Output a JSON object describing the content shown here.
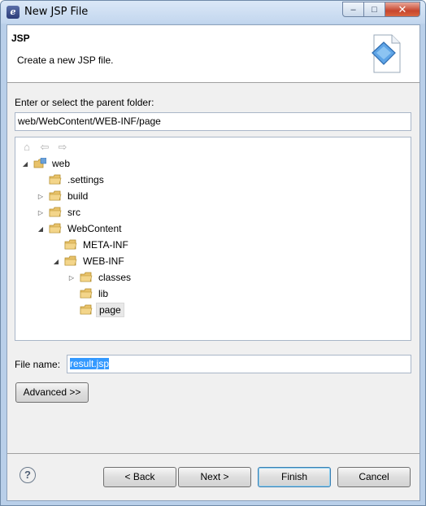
{
  "window": {
    "title": "New JSP File",
    "controls": {
      "minimize": "‒",
      "maximize": "□",
      "close": "✕"
    }
  },
  "banner": {
    "title": "JSP",
    "description": "Create a new JSP file."
  },
  "folder_section": {
    "label": "Enter or select the parent folder:",
    "value": "web/WebContent/WEB-INF/page"
  },
  "tree": {
    "toolbar_icons": [
      "home-icon",
      "back-arrow-icon",
      "forward-arrow-icon"
    ],
    "items": [
      {
        "label": "web",
        "expander": "expanded",
        "type": "project"
      },
      {
        "label": ".settings",
        "expander": "none",
        "type": "folder"
      },
      {
        "label": "build",
        "expander": "collapsed",
        "type": "folder"
      },
      {
        "label": "src",
        "expander": "collapsed",
        "type": "folder"
      },
      {
        "label": "WebContent",
        "expander": "expanded",
        "type": "folder"
      },
      {
        "label": "META-INF",
        "expander": "none",
        "type": "folder"
      },
      {
        "label": "WEB-INF",
        "expander": "expanded",
        "type": "folder"
      },
      {
        "label": "classes",
        "expander": "collapsed",
        "type": "folder"
      },
      {
        "label": "lib",
        "expander": "none",
        "type": "folder"
      },
      {
        "label": "page",
        "expander": "none",
        "type": "folder",
        "selected": true
      }
    ]
  },
  "file_name": {
    "label": "File name:",
    "value": "result.jsp"
  },
  "buttons": {
    "advanced": "Advanced >>",
    "back": "< Back",
    "next": "Next >",
    "finish": "Finish",
    "cancel": "Cancel"
  },
  "help": {
    "glyph": "?"
  },
  "colors": {
    "selection": "#3399ff",
    "folder": "#e8c26a",
    "titlebar": "#c2d6ee"
  }
}
